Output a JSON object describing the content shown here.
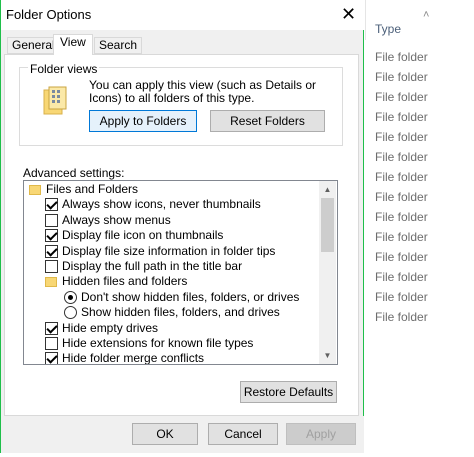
{
  "dialog": {
    "title": "Folder Options",
    "tabs": [
      {
        "label": "General"
      },
      {
        "label": "View"
      },
      {
        "label": "Search"
      }
    ],
    "folder_views": {
      "group_title": "Folder views",
      "description": "You can apply this view (such as Details or Icons) to all folders of this type.",
      "apply_label": "Apply to Folders",
      "reset_label": "Reset Folders"
    },
    "advanced": {
      "label": "Advanced settings:",
      "items": [
        {
          "type": "folder",
          "label": "Files and Folders"
        },
        {
          "type": "checkbox",
          "label": "Always show icons, never thumbnails",
          "checked": true
        },
        {
          "type": "checkbox",
          "label": "Always show menus",
          "checked": false
        },
        {
          "type": "checkbox",
          "label": "Display file icon on thumbnails",
          "checked": true
        },
        {
          "type": "checkbox",
          "label": "Display file size information in folder tips",
          "checked": true
        },
        {
          "type": "checkbox",
          "label": "Display the full path in the title bar",
          "checked": false
        },
        {
          "type": "folder",
          "label": "Hidden files and folders"
        },
        {
          "type": "radio",
          "label": "Don't show hidden files, folders, or drives",
          "checked": true
        },
        {
          "type": "radio",
          "label": "Show hidden files, folders, and drives",
          "checked": false
        },
        {
          "type": "checkbox",
          "label": "Hide empty drives",
          "checked": true
        },
        {
          "type": "checkbox",
          "label": "Hide extensions for known file types",
          "checked": false
        },
        {
          "type": "checkbox",
          "label": "Hide folder merge conflicts",
          "checked": true
        }
      ]
    },
    "restore_label": "Restore Defaults",
    "ok_label": "OK",
    "cancel_label": "Cancel",
    "apply_label": "Apply"
  },
  "background": {
    "column_header": "Type",
    "rows": [
      "File folder",
      "File folder",
      "File folder",
      "File folder",
      "File folder",
      "File folder",
      "File folder",
      "File folder",
      "File folder",
      "File folder",
      "File folder",
      "File folder",
      "File folder",
      "File folder"
    ]
  },
  "colors": {
    "window_border": "#1fbf4a",
    "focus_border": "#0078d7",
    "folder_yellow": "#f8d775"
  }
}
